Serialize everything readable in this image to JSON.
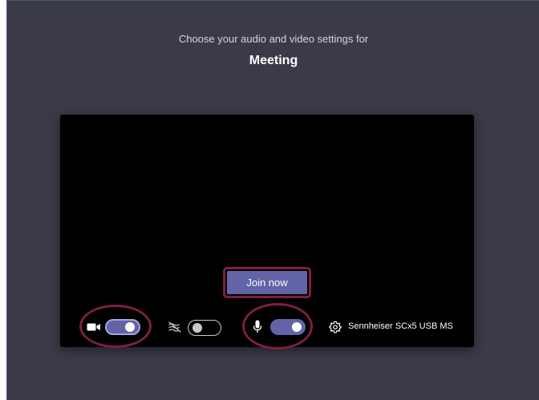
{
  "header": {
    "subtitle": "Choose your audio and video settings for",
    "title": "Meeting"
  },
  "preview": {
    "join_label": "Join now"
  },
  "controls": {
    "camera": {
      "icon": "camera-icon",
      "state": "on"
    },
    "background_effects": {
      "icon": "background-blur-icon",
      "state": "off"
    },
    "microphone": {
      "icon": "microphone-icon",
      "state": "on"
    },
    "device_settings": {
      "icon": "gear-icon",
      "label": "Sennheiser SCx5 USB MS"
    }
  },
  "colors": {
    "background": "#3b3a48",
    "accent": "#6264a7",
    "highlight_ring": "#7f1e3d"
  }
}
